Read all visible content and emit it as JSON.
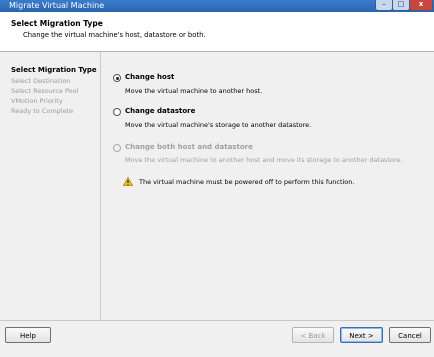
{
  "window": {
    "title": "Migrate Virtual Machine",
    "controls": {
      "minimize": "–",
      "maximize": "□",
      "close": "x"
    }
  },
  "header": {
    "title": "Select Migration Type",
    "subtitle": "Change the virtual machine's host, datastore or both."
  },
  "steps": [
    {
      "label": "Select Migration Type",
      "active": true
    },
    {
      "label": "Select Destination",
      "active": false
    },
    {
      "label": "Select Resource Pool",
      "active": false
    },
    {
      "label": "VMotion Priority",
      "active": false
    },
    {
      "label": "Ready to Complete",
      "active": false
    }
  ],
  "options": [
    {
      "label": "Change host",
      "description": "Move the virtual machine to another host.",
      "selected": true,
      "enabled": true
    },
    {
      "label": "Change datastore",
      "description": "Move the virtual machine's storage to another datastore.",
      "selected": false,
      "enabled": true
    },
    {
      "label": "Change both host and datastore",
      "description": "Move the virtual machine to another host and move its storage to another datastore.",
      "selected": false,
      "enabled": false
    }
  ],
  "warning": {
    "icon": "warning-icon",
    "text": "The virtual machine must be powered off to perform this function."
  },
  "footer": {
    "help": "Help",
    "back": "< Back",
    "next": "Next >",
    "cancel": "Cancel"
  }
}
